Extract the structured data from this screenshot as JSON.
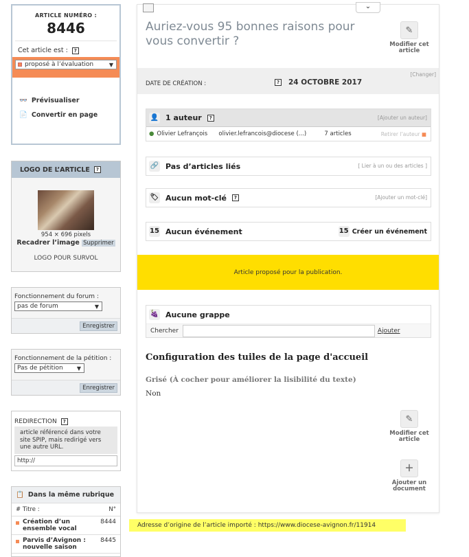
{
  "article_box": {
    "number_label": "ARTICLE NUMÉRO :",
    "number": "8446",
    "status_label": "Cet article est :",
    "status_value": "proposé à l’évaluation",
    "actions": [
      {
        "label": "Prévisualiser",
        "icon": "preview-icon"
      },
      {
        "label": "Convertir en page",
        "icon": "convert-page-icon"
      }
    ],
    "status_color": "#f58b55"
  },
  "logo_box": {
    "title": "LOGO DE L’ARTICLE",
    "dimensions": "954 × 696 pixels",
    "recadrer": "Recadrer l’image",
    "supprimer": "Supprimer",
    "survol": "LOGO POUR SURVOL"
  },
  "forum_box": {
    "label": "Fonctionnement du forum :",
    "value": "pas de forum",
    "button": "Enregistrer"
  },
  "petition_box": {
    "label": "Fonctionnement de la pétition :",
    "value": "Pas de pétition",
    "button": "Enregistrer"
  },
  "redirect_box": {
    "title": "REDIRECTION",
    "info": "article référencé dans votre site SPIP, mais redirigé vers une autre URL.",
    "value": "http://"
  },
  "rubrique_box": {
    "title": "Dans la même rubrique",
    "col_title": "# Titre :",
    "col_num": "N°",
    "rows": [
      {
        "title": "Création d’un ensemble vocal",
        "num": "8444"
      },
      {
        "title": "Parvis d’Avignon : nouvelle saison",
        "num": "8445"
      }
    ]
  },
  "main": {
    "title": "Auriez-vous 95 bonnes raisons pour vous convertir ?",
    "edit_label": "Modifier cet article",
    "date_label": "DATE DE CRÉATION :",
    "date_value": "24 OCTOBRE 2017",
    "date_change": "[Changer]",
    "authors": {
      "title": "1 auteur",
      "add_link": "[Ajouter un auteur]",
      "rows": [
        {
          "name": "Olivier Lefrançois",
          "email": "olivier.lefrancois@diocese (...)",
          "count": "7 articles",
          "remove": "Retirer l’auteur"
        }
      ]
    },
    "linked": {
      "title": "Pas d’articles liés",
      "link": "[ Lier à un ou des articles ]"
    },
    "keywords": {
      "title": "Aucun mot-clé",
      "link": "[Ajouter un mot-clé]"
    },
    "events": {
      "title": "Aucun événement",
      "create": "Créer un événement"
    },
    "notice": "Article proposé pour la publication.",
    "notice_color": "#ffde00",
    "grappe": {
      "title": "Aucune grappe",
      "search_label": "Chercher",
      "add_label": "Ajouter"
    },
    "config": {
      "title": "Configuration des tuiles de la page d'accueil",
      "field_label": "Grisé (À cocher pour améliorer la lisibilité du texte)",
      "field_value": "Non"
    },
    "bottom_actions": [
      {
        "label": "Modifier cet article",
        "icon": "edit-article-icon"
      },
      {
        "label": "Ajouter un document",
        "icon": "add-document-icon"
      }
    ]
  },
  "import_notice": {
    "label": "Adresse d’origine de l’article importé :",
    "url": "https://www.diocese-avignon.fr/11914"
  }
}
